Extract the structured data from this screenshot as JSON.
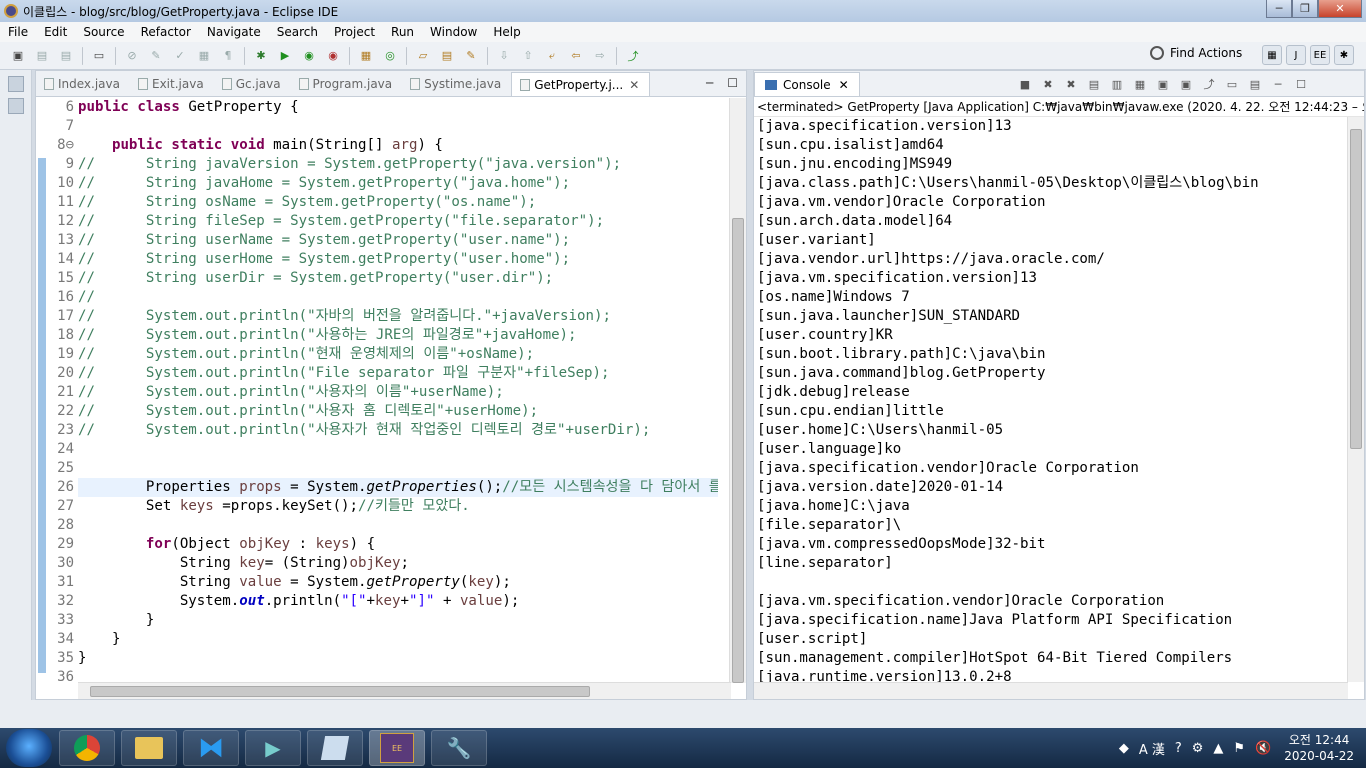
{
  "window": {
    "title": "이클립스 - blog/src/blog/GetProperty.java - Eclipse IDE",
    "min": "─",
    "max": "❐",
    "close": "✕"
  },
  "menu": [
    "File",
    "Edit",
    "Source",
    "Refactor",
    "Navigate",
    "Search",
    "Project",
    "Run",
    "Window",
    "Help"
  ],
  "toolbar": {
    "find_actions": "Find Actions"
  },
  "editor": {
    "tabs": [
      {
        "label": "Index.java"
      },
      {
        "label": "Exit.java"
      },
      {
        "label": "Gc.java"
      },
      {
        "label": "Program.java"
      },
      {
        "label": "Systime.java"
      },
      {
        "label": "GetProperty.j..."
      }
    ],
    "line_numbers": [
      "6",
      "7",
      "8⊖",
      "9",
      "10",
      "11",
      "12",
      "13",
      "14",
      "15",
      "16",
      "17",
      "18",
      "19",
      "20",
      "21",
      "22",
      "23",
      "24",
      "25",
      "26",
      "27",
      "28",
      "29",
      "30",
      "31",
      "32",
      "33",
      "34",
      "35",
      "36"
    ]
  },
  "console": {
    "tab_label": "Console",
    "terminated": "<terminated> GetProperty [Java Application] C:₩java₩bin₩javaw.exe  (2020. 4. 22. 오전 12:44:23 – 오전 12:44:2",
    "output": [
      "[java.specification.version]13",
      "[sun.cpu.isalist]amd64",
      "[sun.jnu.encoding]MS949",
      "[java.class.path]C:\\Users\\hanmil-05\\Desktop\\이클립스\\blog\\bin",
      "[java.vm.vendor]Oracle Corporation",
      "[sun.arch.data.model]64",
      "[user.variant]",
      "[java.vendor.url]https://java.oracle.com/",
      "[java.vm.specification.version]13",
      "[os.name]Windows 7",
      "[sun.java.launcher]SUN_STANDARD",
      "[user.country]KR",
      "[sun.boot.library.path]C:\\java\\bin",
      "[sun.java.command]blog.GetProperty",
      "[jdk.debug]release",
      "[sun.cpu.endian]little",
      "[user.home]C:\\Users\\hanmil-05",
      "[user.language]ko",
      "[java.specification.vendor]Oracle Corporation",
      "[java.version.date]2020-01-14",
      "[java.home]C:\\java",
      "[file.separator]\\",
      "[java.vm.compressedOopsMode]32-bit",
      "[line.separator]",
      "",
      "[java.vm.specification.vendor]Oracle Corporation",
      "[java.specification.name]Java Platform API Specification",
      "[user.script]",
      "[sun.management.compiler]HotSpot 64-Bit Tiered Compilers",
      "[java.runtime.version]13.0.2+8"
    ]
  },
  "taskbar": {
    "apps": [
      "Chrome",
      "Explorer",
      "VS Code",
      "Media",
      "Notepad",
      "Java EE IDE",
      "Tools"
    ],
    "tray_lang": "A 漢",
    "clock_time": "오전 12:44",
    "clock_date": "2020-04-22"
  },
  "colors": {
    "keyword": "#7f0055",
    "comment": "#3f7f5f",
    "string": "#2a00ff",
    "field": "#0000c0",
    "taskbar": "#1b365a"
  }
}
